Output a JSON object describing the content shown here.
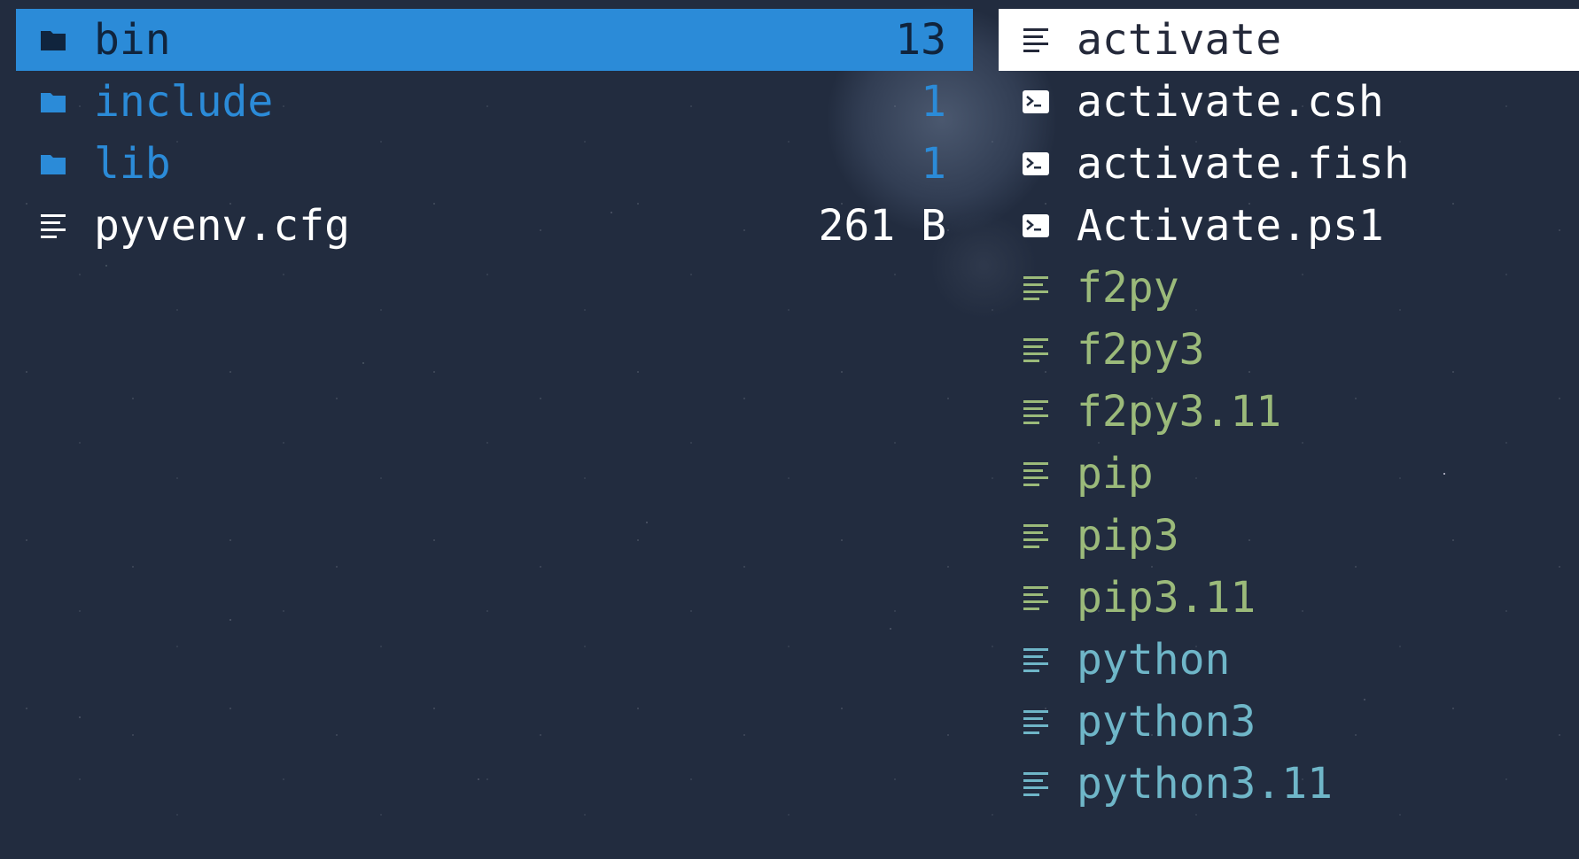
{
  "colors": {
    "background": "#222c3f",
    "selection_blue": "#2b8bd8",
    "selection_white": "#ffffff",
    "folder_text": "#2b8bd8",
    "executable_green": "#9bba7a",
    "python_cyan": "#6fb6c8"
  },
  "left_pane": {
    "items": [
      {
        "name": "bin",
        "size": "13",
        "icon": "folder-icon",
        "selected": true
      },
      {
        "name": "include",
        "size": "1",
        "icon": "folder-icon"
      },
      {
        "name": "lib",
        "size": "1",
        "icon": "folder-icon"
      },
      {
        "name": "pyvenv.cfg",
        "size": "261 B",
        "icon": "text-file-icon"
      }
    ]
  },
  "right_pane": {
    "items": [
      {
        "name": "activate",
        "icon": "text-file-icon",
        "selected": true
      },
      {
        "name": "activate.csh",
        "icon": "terminal-icon"
      },
      {
        "name": "activate.fish",
        "icon": "terminal-icon"
      },
      {
        "name": "Activate.ps1",
        "icon": "terminal-icon"
      },
      {
        "name": "f2py",
        "icon": "text-file-icon"
      },
      {
        "name": "f2py3",
        "icon": "text-file-icon"
      },
      {
        "name": "f2py3.11",
        "icon": "text-file-icon"
      },
      {
        "name": "pip",
        "icon": "text-file-icon"
      },
      {
        "name": "pip3",
        "icon": "text-file-icon"
      },
      {
        "name": "pip3.11",
        "icon": "text-file-icon"
      },
      {
        "name": "python",
        "icon": "text-file-icon"
      },
      {
        "name": "python3",
        "icon": "text-file-icon"
      },
      {
        "name": "python3.11",
        "icon": "text-file-icon"
      }
    ]
  }
}
